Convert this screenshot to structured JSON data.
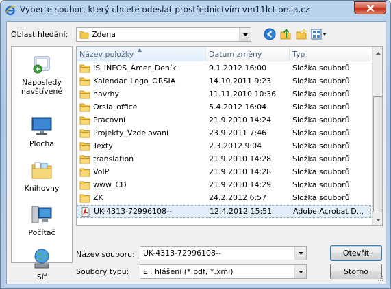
{
  "window": {
    "title": "Vyberte soubor, který chcete odeslat prostřednictvím vm11lct.orsia.cz",
    "app_icon": "ie-icon",
    "close_icon": "close-icon"
  },
  "lookin": {
    "label": "Oblast hledání:",
    "value": "Zdena",
    "icon": "folder-icon"
  },
  "toolbar": {
    "back_icon": "back-arrow-icon",
    "up_icon": "up-folder-icon",
    "new_folder_icon": "new-folder-icon",
    "views_icon": "views-menu-icon"
  },
  "places": [
    {
      "label": "Naposledy navštívené",
      "icon": "recent-places-icon"
    },
    {
      "label": "Plocha",
      "icon": "desktop-icon"
    },
    {
      "label": "Knihovny",
      "icon": "libraries-icon"
    },
    {
      "label": "Počítač",
      "icon": "computer-icon"
    },
    {
      "label": "Síť",
      "icon": "network-icon"
    }
  ],
  "columns": {
    "name": "Název položky",
    "date": "Datum změny",
    "type": "Typ"
  },
  "files": [
    {
      "name": "IS_INFOS_Amer_Deník",
      "date": "9.1.2012 16:00",
      "type": "Složka souborů",
      "icon": "folder-icon"
    },
    {
      "name": "Kalendar_Logo_ORSIA",
      "date": "14.10.2011 9:23",
      "type": "Složka souborů",
      "icon": "folder-icon"
    },
    {
      "name": "navrhy",
      "date": "11.11.2010 10:36",
      "type": "Složka souborů",
      "icon": "folder-icon"
    },
    {
      "name": "Orsia_office",
      "date": "5.4.2012 16:04",
      "type": "Složka souborů",
      "icon": "folder-icon"
    },
    {
      "name": "Pracovní",
      "date": "21.9.2010 14:24",
      "type": "Složka souborů",
      "icon": "folder-icon"
    },
    {
      "name": "Projekty_Vzdelavani",
      "date": "23.9.2011 7:46",
      "type": "Složka souborů",
      "icon": "folder-icon"
    },
    {
      "name": "Texty",
      "date": "2.3.2012 9:04",
      "type": "Složka souborů",
      "icon": "folder-icon"
    },
    {
      "name": "translation",
      "date": "21.9.2010 14:28",
      "type": "Složka souborů",
      "icon": "folder-icon"
    },
    {
      "name": "VoIP",
      "date": "21.9.2010 14:28",
      "type": "Složka souborů",
      "icon": "folder-icon"
    },
    {
      "name": "www_CD",
      "date": "21.9.2010 14:29",
      "type": "Složka souborů",
      "icon": "folder-icon"
    },
    {
      "name": "ZK",
      "date": "24.2.2012 6:57",
      "type": "Složka souborů",
      "icon": "folder-icon"
    },
    {
      "name": "UK-4313-72996108--",
      "date": "12.4.2012 15:51",
      "type": "Adobe Acrobat D...",
      "icon": "pdf-icon",
      "selected": true
    }
  ],
  "filename": {
    "label": "Název souboru:",
    "value": "UK-4313-72996108--"
  },
  "filetype": {
    "label": "Soubory typu:",
    "value": "El. hlášení (*.pdf, *.xml)"
  },
  "buttons": {
    "open": "Otevřít",
    "cancel": "Storno"
  },
  "colors": {
    "selection": "#e2edfa",
    "folder": "#f2c94c",
    "pdf": "#d9251c"
  }
}
